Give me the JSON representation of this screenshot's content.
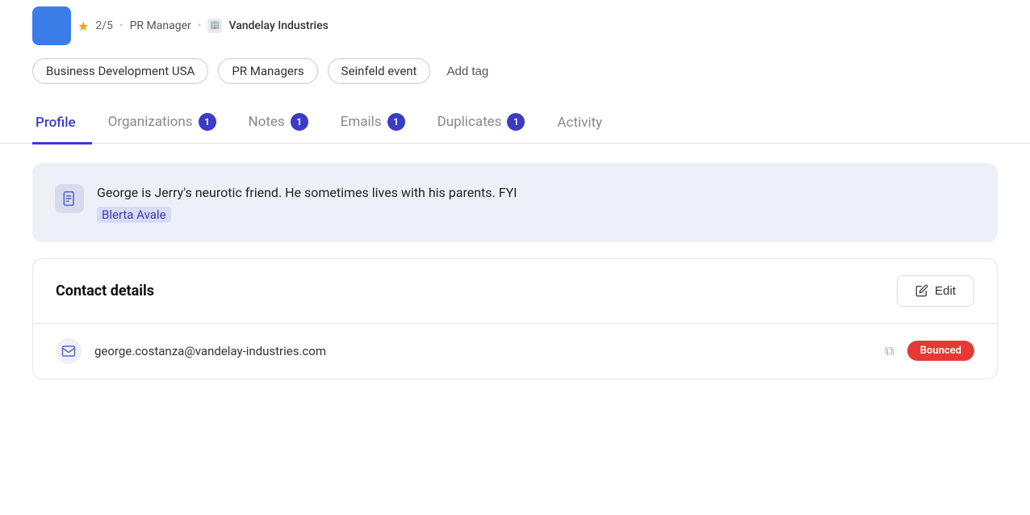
{
  "breadcrumb": {
    "rating": "2/5",
    "rating_star": "★",
    "role": "PR Manager",
    "company": "Vandelay Industries"
  },
  "tags": [
    {
      "label": "Business Development USA"
    },
    {
      "label": "PR Managers"
    },
    {
      "label": "Seinfeld event"
    }
  ],
  "add_tag_label": "Add tag",
  "tabs": [
    {
      "id": "profile",
      "label": "Profile",
      "badge": null,
      "active": true
    },
    {
      "id": "organizations",
      "label": "Organizations",
      "badge": "1",
      "active": false
    },
    {
      "id": "notes",
      "label": "Notes",
      "badge": "1",
      "active": false
    },
    {
      "id": "emails",
      "label": "Emails",
      "badge": "1",
      "active": false
    },
    {
      "id": "duplicates",
      "label": "Duplicates",
      "badge": "1",
      "active": false
    },
    {
      "id": "activity",
      "label": "Activity",
      "badge": null,
      "active": false
    }
  ],
  "note": {
    "text": "George is Jerry's neurotic friend. He sometimes lives with his parents. FYI",
    "author": "Blerta Avale"
  },
  "contact_details": {
    "title": "Contact details",
    "edit_label": "Edit",
    "email": "george.costanza@vandelay-industries.com",
    "email_status": "Bounced"
  }
}
